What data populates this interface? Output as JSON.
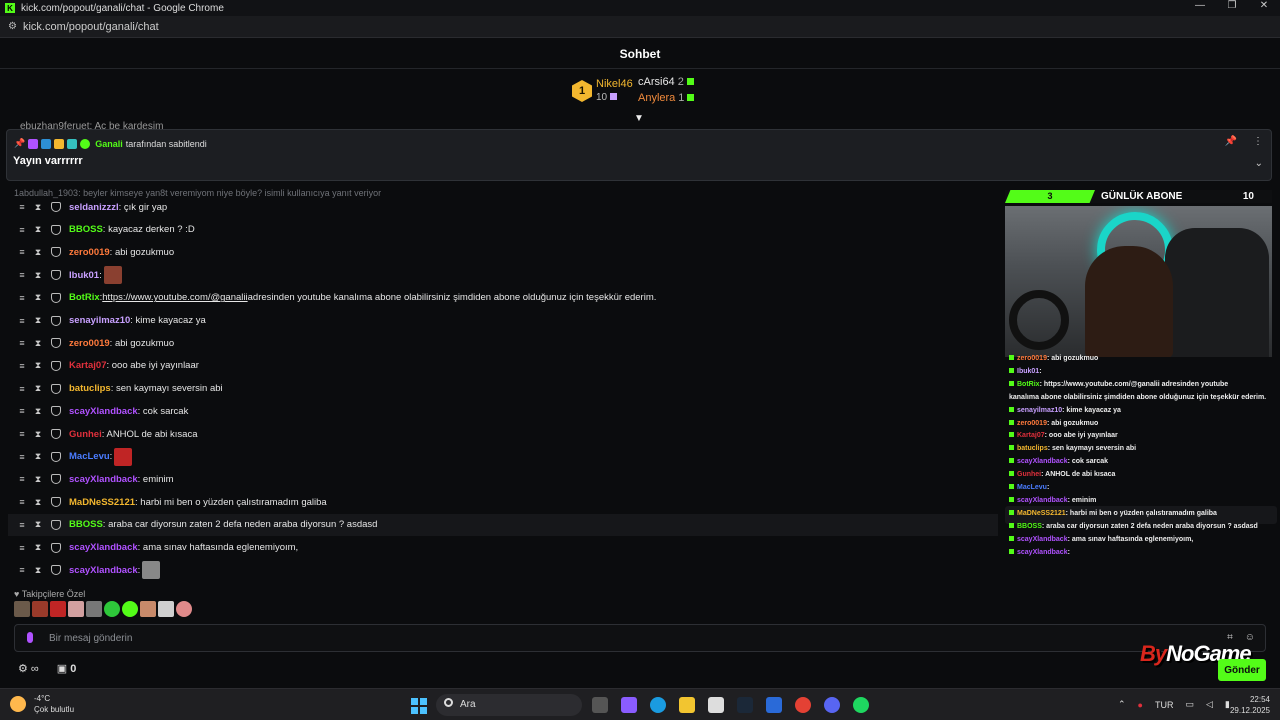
{
  "window": {
    "title": "kick.com/popout/ganali/chat - Google Chrome",
    "url": "kick.com/popout/ganali/chat"
  },
  "header": {
    "title": "Sohbet"
  },
  "gifters": {
    "first": {
      "name": "Nikel46",
      "count": "10",
      "rank": "1"
    },
    "second": {
      "name": "cArsi64",
      "count": "2"
    },
    "third": {
      "name": "Anylera",
      "count": "1"
    }
  },
  "cut_row": "ebuzhan9feruet: Aç be kardeşim",
  "pinned": {
    "author": "Ganali",
    "by_text": "tarafından sabitlendi",
    "message": "Yayın varrrrrr"
  },
  "reply_hint": "1abdullah_1903: beyler kimseye yan8t veremiyom niye böyle? isimli kullanıcıya yanıt veriyor",
  "messages": [
    {
      "user": "seldanizzzl",
      "color": "#c8a0ff",
      "text": ": çık gir yap"
    },
    {
      "user": "BBOSS",
      "color": "#53fc18",
      "text": ": kayacaz derken ? :D"
    },
    {
      "user": "zero0019",
      "color": "#ff7a3c",
      "text": ": abi gozukmuo"
    },
    {
      "user": "Ibuk01",
      "color": "#c8a0ff",
      "text": ":"
    },
    {
      "user": "BotRix",
      "color": "#53fc18",
      "text": " adresinden youtube kanalıma abone olabilirsiniz şimdiden abone olduğunuz için teşekkür ederim.",
      "link": "https://www.youtube.com/@ganalii"
    },
    {
      "user": "senayilmaz10",
      "color": "#c8a0ff",
      "text": ": kime kayacaz ya"
    },
    {
      "user": "zero0019",
      "color": "#ff7a3c",
      "text": ": abi gozukmuo"
    },
    {
      "user": "Kartaj07",
      "color": "#e0303c",
      "text": ": ooo abe iyi yayınlaar"
    },
    {
      "user": "batuclips",
      "color": "#f3b72f",
      "text": ": sen kaymayı seversin abi"
    },
    {
      "user": "scayXlandback",
      "color": "#b052ff",
      "text": ": cok sarcak"
    },
    {
      "user": "Gunhei",
      "color": "#e0303c",
      "text": ": ANHOL de abi kısaca"
    },
    {
      "user": "MacLevu",
      "color": "#4a7cff",
      "text": ":"
    },
    {
      "user": "scayXlandback",
      "color": "#b052ff",
      "text": ": eminim"
    },
    {
      "user": "MaDNeSS2121",
      "color": "#f3b72f",
      "text": ": harbi mi ben o yüzden çalıstıramadım galiba"
    },
    {
      "user": "BBOSS",
      "color": "#53fc18",
      "text": ": araba car diyorsun zaten 2 defa neden araba diyorsun ? asdasd"
    },
    {
      "user": "scayXlandback",
      "color": "#b052ff",
      "text": ": ama sınav haftasında eglenemiyoım,"
    },
    {
      "user": "scayXlandback",
      "color": "#b052ff",
      "text": ":"
    }
  ],
  "follow_label": "Takipçilere Özel",
  "input": {
    "placeholder": "Bir mesaj gönderin",
    "send": "Gönder"
  },
  "bottom": {
    "count": "0"
  },
  "watermark": {
    "a": "By",
    "b": "NoGame"
  },
  "overlay": {
    "bar_num": "3",
    "title": "GÜNLÜK ABONE",
    "goal": "10",
    "chat": [
      {
        "user": "zero0019",
        "color": "#ff7a3c",
        "text": ": abi gozukmuo"
      },
      {
        "user": "Ibuk01",
        "color": "#c8a0ff",
        "text": ":"
      },
      {
        "user": "BotRix",
        "color": "#53fc18",
        "text": ": https://www.youtube.com/@ganalii adresinden youtube"
      },
      {
        "user": "",
        "color": "#eee",
        "text": "kanalıma abone olabilirsiniz şimdiden abone olduğunuz için teşekkür ederim."
      },
      {
        "user": "senayilmaz10",
        "color": "#c8a0ff",
        "text": ": kime kayacaz ya"
      },
      {
        "user": "zero0019",
        "color": "#ff7a3c",
        "text": ": abi gozukmuo"
      },
      {
        "user": "Kartaj07",
        "color": "#e0303c",
        "text": ": ooo abe iyi yayınlaar"
      },
      {
        "user": "batuclips",
        "color": "#f3b72f",
        "text": ": sen kaymayı seversin abi"
      },
      {
        "user": "scayXlandback",
        "color": "#b052ff",
        "text": ": cok sarcak"
      },
      {
        "user": "Gunhei",
        "color": "#e0303c",
        "text": ": ANHOL de abi kısaca"
      },
      {
        "user": "MacLevu",
        "color": "#4a7cff",
        "text": ":"
      },
      {
        "user": "scayXlandback",
        "color": "#b052ff",
        "text": ": eminim"
      },
      {
        "user": "MaDNeSS2121",
        "color": "#f3b72f",
        "text": ": harbi mi ben o yüzden çalıstıramadım galiba"
      },
      {
        "user": "BBOSS",
        "color": "#53fc18",
        "text": ": araba car diyorsun zaten 2 defa neden araba diyorsun ? asdasd"
      },
      {
        "user": "scayXlandback",
        "color": "#b052ff",
        "text": ": ama sınav haftasında eglenemiyoım,"
      },
      {
        "user": "scayXlandback",
        "color": "#b052ff",
        "text": ":"
      }
    ]
  },
  "taskbar": {
    "temp": "-4°C",
    "weather": "Çok bulutlu",
    "search": "Ara",
    "lang": "TUR",
    "time": "22:54",
    "date": "29.12.2025"
  }
}
